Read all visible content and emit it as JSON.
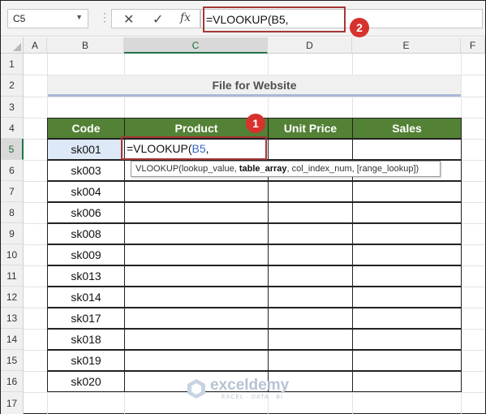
{
  "formula_bar": {
    "name_box": "C5",
    "dropdown_icon": "chevron-down-icon",
    "cancel_icon": "✕",
    "enter_icon": "✓",
    "fx_icon": "fx",
    "formula": "=VLOOKUP(B5,"
  },
  "columns": [
    "A",
    "B",
    "C",
    "D",
    "E",
    "F"
  ],
  "rows": [
    "1",
    "2",
    "3",
    "4",
    "5",
    "6",
    "7",
    "8",
    "9",
    "10",
    "11",
    "12",
    "13",
    "14",
    "15",
    "16",
    "17"
  ],
  "sheet": {
    "title": "File for Website",
    "headers": [
      "Code",
      "Product",
      "Unit Price",
      "Sales"
    ],
    "codes": [
      "sk001",
      "sk003",
      "sk004",
      "sk006",
      "sk008",
      "sk009",
      "sk013",
      "sk014",
      "sk017",
      "sk018",
      "sk019",
      "sk020"
    ],
    "edit_cell": {
      "prefix": "=VLOOKUP(",
      "ref": "B5",
      "suffix": ","
    }
  },
  "tooltip": {
    "fn": "VLOOKUP(",
    "arg1": "lookup_value, ",
    "arg2": "table_array",
    "rest": ", col_index_num, [range_lookup])"
  },
  "badges": [
    "1",
    "2"
  ],
  "watermark": {
    "name": "exceldemy",
    "tagline": "EXCEL · DATA · BI"
  },
  "colors": {
    "header_green": "#538135",
    "badge_red": "#d7322d",
    "box_red": "#a63636",
    "ref_blue": "#3367c6"
  }
}
